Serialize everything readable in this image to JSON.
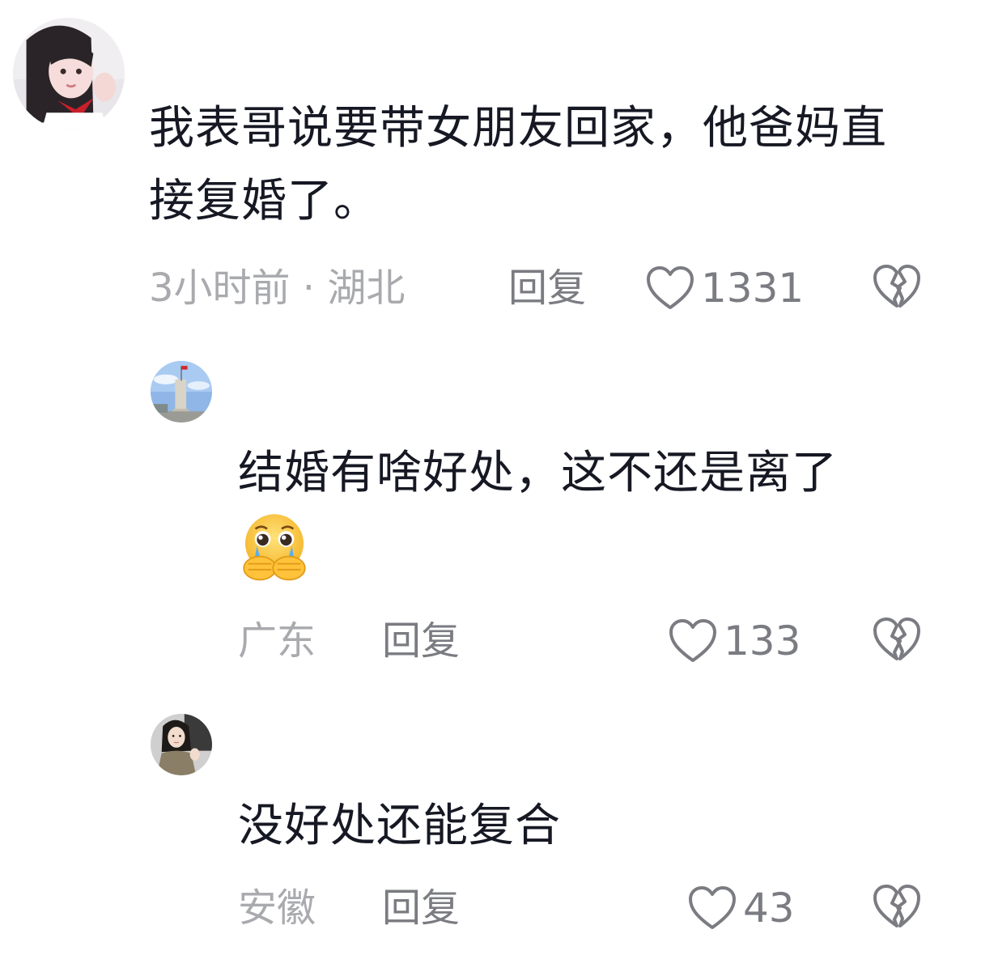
{
  "comments": [
    {
      "avatar": "avatar-girl-icon",
      "text": "我表哥说要带女朋友回家，他爸妈直接复婚了。",
      "time_location": "3小时前 · 湖北",
      "reply_label": "回复",
      "likes": "1331"
    },
    {
      "avatar": "avatar-monument-icon",
      "text": "结婚有啥好处，这不还是离了",
      "emoji": "crying-hands-emoji",
      "time_location": "广东",
      "reply_label": "回复",
      "likes": "133"
    },
    {
      "avatar": "avatar-woman-icon",
      "text": "没好处还能复合",
      "time_location": "安徽",
      "reply_label": "回复",
      "likes": "43"
    }
  ],
  "colors": {
    "text": "#161823",
    "meta": "#a9aaae",
    "action": "#7b7c82"
  }
}
